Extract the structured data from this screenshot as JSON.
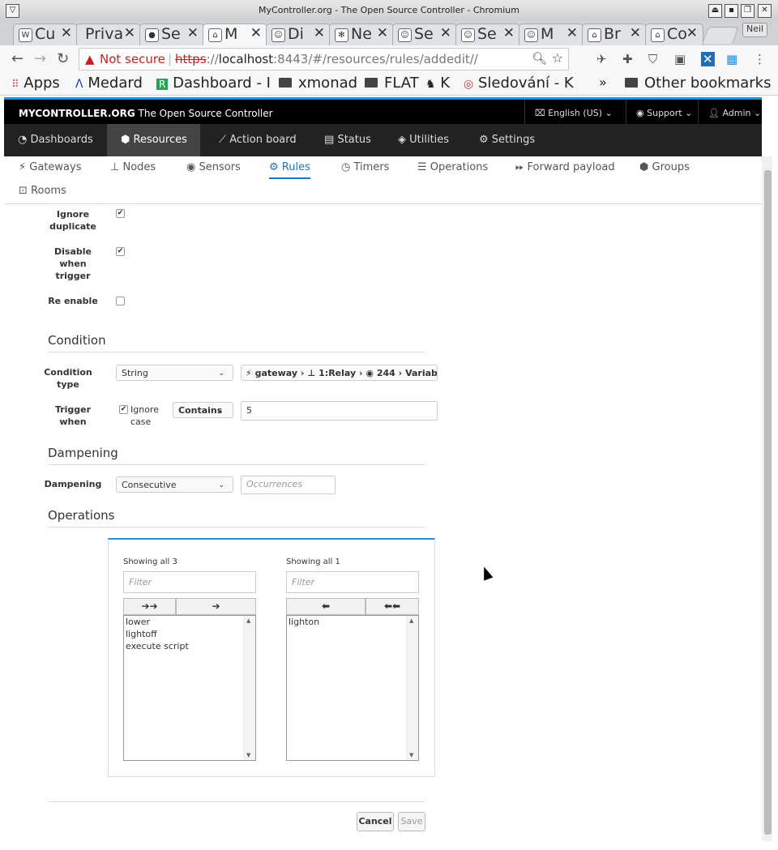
{
  "window": {
    "title": "MyController.org - The Open Source Controller - Chromium",
    "user": "Neil"
  },
  "tabs": [
    {
      "label": "Cu",
      "icon": "W"
    },
    {
      "label": "Priva",
      "icon": ""
    },
    {
      "label": "Se",
      "icon": "gh"
    },
    {
      "label": "M",
      "icon": "mc",
      "active": true
    },
    {
      "label": "Di",
      "icon": "?"
    },
    {
      "label": "Ne",
      "icon": "*"
    },
    {
      "label": "Se",
      "icon": "?"
    },
    {
      "label": "Se",
      "icon": "?"
    },
    {
      "label": "M",
      "icon": "?"
    },
    {
      "label": "Br",
      "icon": "mc"
    },
    {
      "label": "Co",
      "icon": "mc"
    }
  ],
  "address": {
    "security": "Not secure",
    "scheme": "https",
    "host": "localhost",
    "rest": ":8443/#/resources/rules/addedit//"
  },
  "bookmarks": [
    "Apps",
    "Medard",
    "Dashboard - I",
    "xmonad",
    "FLAT",
    "K",
    "Sledování - K",
    "»",
    "Other bookmarks"
  ],
  "app": {
    "brand_bold": "MYCONTROLLER.ORG",
    "brand_rest": "The Open Source Controller",
    "language": "English (US)",
    "support": "Support",
    "admin": "Admin",
    "main_nav": [
      "Dashboards",
      "Resources",
      "Action board",
      "Status",
      "Utilities",
      "Settings"
    ],
    "sub_nav": [
      "Gateways",
      "Nodes",
      "Sensors",
      "Rules",
      "Timers",
      "Operations",
      "Forward payload",
      "Groups",
      "Rooms"
    ]
  },
  "form": {
    "ignore_duplicate_label": "Ignore duplicate",
    "ignore_duplicate_checked": true,
    "disable_when_trigger_label": "Disable when trigger",
    "disable_when_trigger_checked": true,
    "re_enable_label": "Re enable",
    "re_enable_checked": false,
    "condition_section": "Condition",
    "condition_type_label": "Condition type",
    "condition_type_value": "String",
    "resource_path": [
      "gateway",
      "1:Relay",
      "244",
      "Variab"
    ],
    "trigger_when_label": "Trigger when",
    "ignore_case_label": "Ignore case",
    "ignore_case_checked": true,
    "operator_value": "Contains",
    "trigger_value": "5",
    "dampening_section": "Dampening",
    "dampening_label": "Dampening",
    "dampening_value": "Consecutive",
    "occurrences_placeholder": "Occurrences",
    "operations_section": "Operations",
    "available": {
      "header": "Showing all 3",
      "filter_placeholder": "Filter",
      "items": [
        "lower",
        "lightoff",
        "execute script"
      ]
    },
    "selected": {
      "header": "Showing all 1",
      "filter_placeholder": "Filter",
      "items": [
        "lighton"
      ]
    },
    "cancel": "Cancel",
    "save": "Save"
  }
}
